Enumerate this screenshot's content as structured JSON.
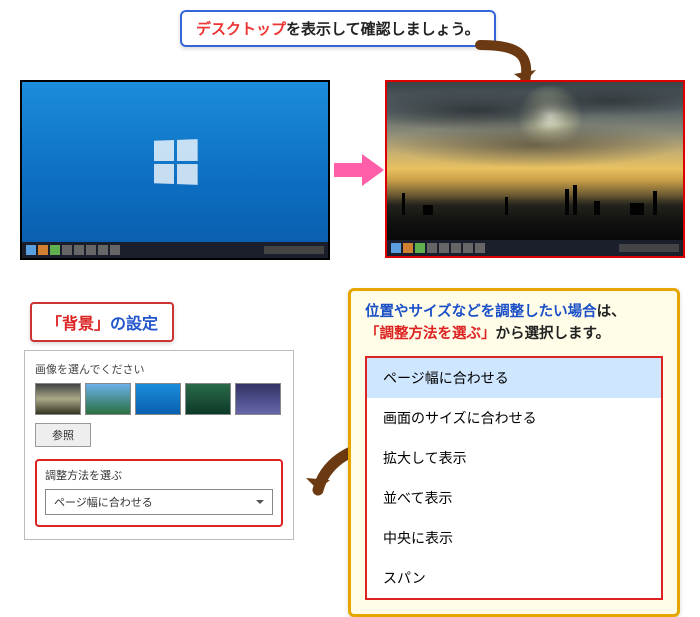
{
  "callout_top": {
    "hl": "デスクトップ",
    "rest": "を表示して確認しましょう。"
  },
  "panel_title": {
    "quoted": "「背景」",
    "rest": "の設定"
  },
  "settings": {
    "choose_label": "画像を選んでください",
    "browse": "参照",
    "fit_label": "調整方法を選ぶ",
    "fit_value": "ページ幅に合わせる"
  },
  "right": {
    "line1_blue": "位置やサイズなどを調整したい場合",
    "line1_rest": "は、",
    "line2_red": "「調整方法を選ぶ」",
    "line2_rest": "から選択します。",
    "options": [
      "ページ幅に合わせる",
      "画面のサイズに合わせる",
      "拡大して表示",
      "並べて表示",
      "中央に表示",
      "スパン"
    ]
  }
}
